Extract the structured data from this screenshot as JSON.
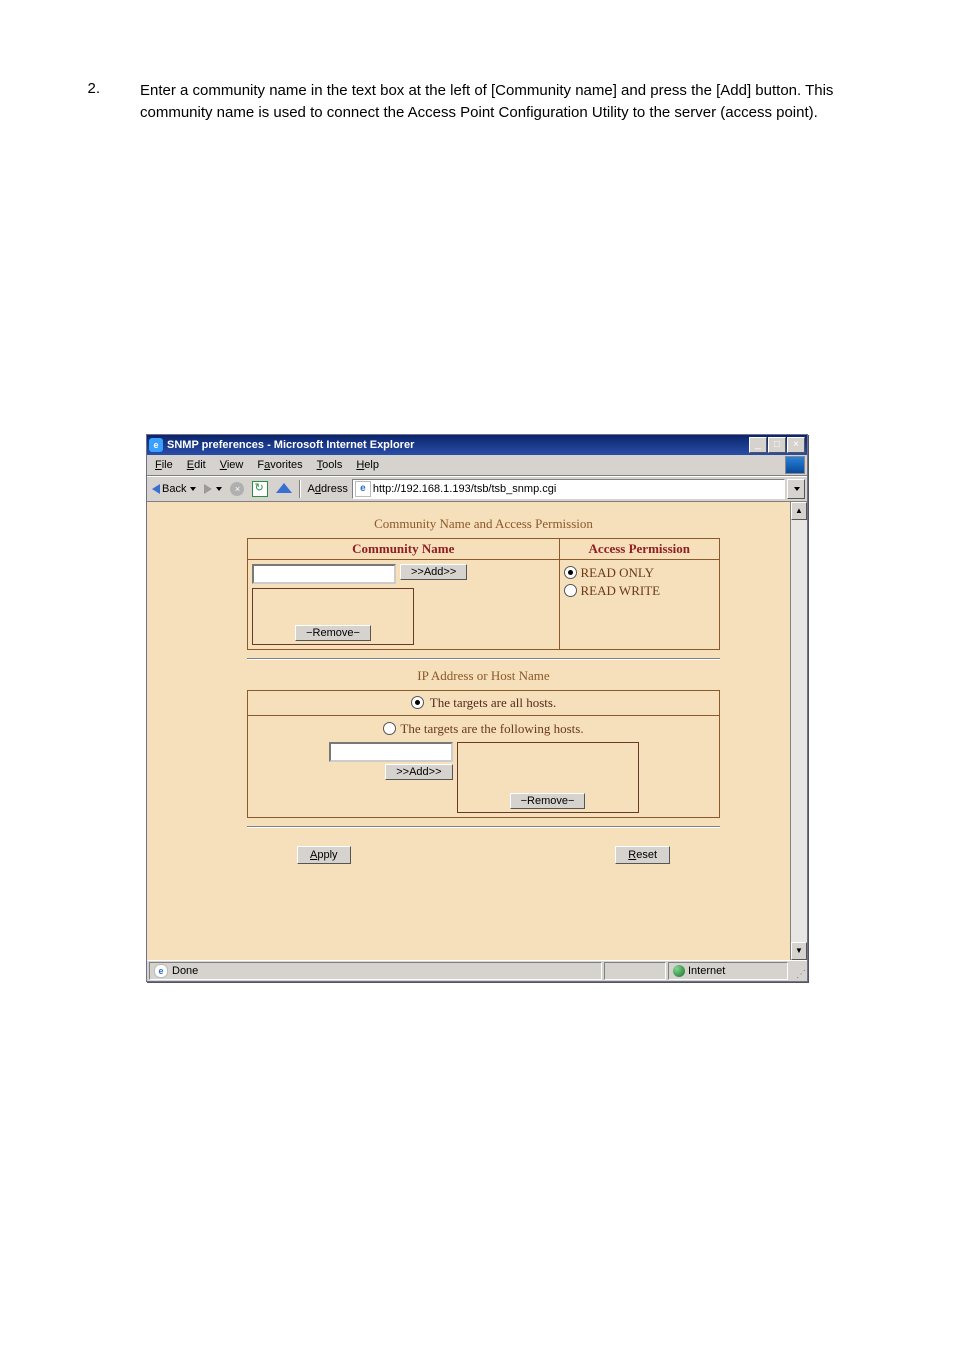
{
  "instruction": {
    "number": "2.",
    "text": "Enter a community name in the text box at the left of [Community name] and press the [Add] button. This community name is used to connect the Access Point Configuration Utility to the server (access point)."
  },
  "window": {
    "title": "SNMP preferences - Microsoft Internet Explorer",
    "menus": {
      "file": "File",
      "edit": "Edit",
      "view": "View",
      "favorites": "Favorites",
      "tools": "Tools",
      "help": "Help"
    },
    "toolbar": {
      "back": "Back",
      "address_label": "Address",
      "url": "http://192.168.1.193/tsb/tsb_snmp.cgi"
    },
    "content": {
      "section1_title": "Community Name and Access Permission",
      "col_community": "Community Name",
      "col_permission": "Access Permission",
      "add_btn": ">>Add>>",
      "remove_btn": "−Remove−",
      "perm_read_only": "READ ONLY",
      "perm_read_write": "READ WRITE",
      "section2_title": "IP Address or Host Name",
      "targets_all": "The targets are all hosts.",
      "targets_following": "The targets are the following hosts.",
      "apply": "Apply",
      "reset": "Reset"
    },
    "status": {
      "done": "Done",
      "zone": "Internet"
    }
  }
}
